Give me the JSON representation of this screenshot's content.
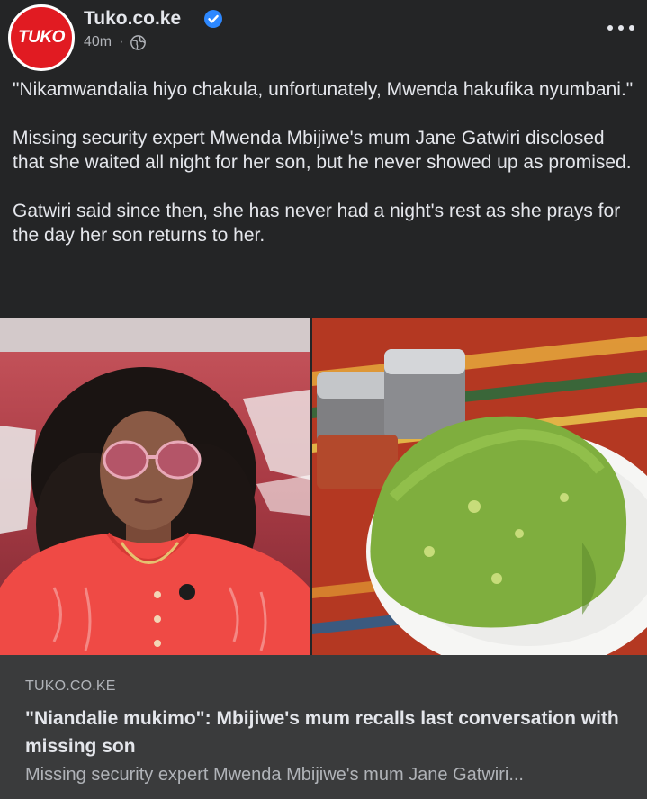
{
  "header": {
    "avatar_text": "TUKO",
    "page_name": "Tuko.co.ke",
    "time": "40m",
    "separator": "·"
  },
  "post": {
    "paragraphs": [
      "\"Nikamwandalia hiyo chakula, unfortunately, Mwenda hakufika nyumbani.\"",
      "Missing security expert Mwenda Mbijiwe's mum Jane Gatwiri disclosed that she waited all night for her son, but he never showed up as promised.",
      "Gatwiri said since then, she has never had a night's rest as she prays for the day her son returns to her."
    ]
  },
  "link_card": {
    "domain": "TUKO.CO.KE",
    "title": "\"Niandalie mukimo\": Mbijiwe's mum recalls last conversation with missing son",
    "description": "Missing security expert Mwenda Mbijiwe's mum Jane Gatwiri..."
  },
  "colors": {
    "background": "#242526",
    "card_background": "#3a3b3c",
    "brand_red": "#e11b22",
    "verified_blue": "#2d88ff",
    "primary_text": "#e4e6eb",
    "secondary_text": "#b0b3b8"
  },
  "icons": {
    "verified": "verified-badge-icon",
    "audience": "globe-icon",
    "more": "more-options-icon"
  }
}
